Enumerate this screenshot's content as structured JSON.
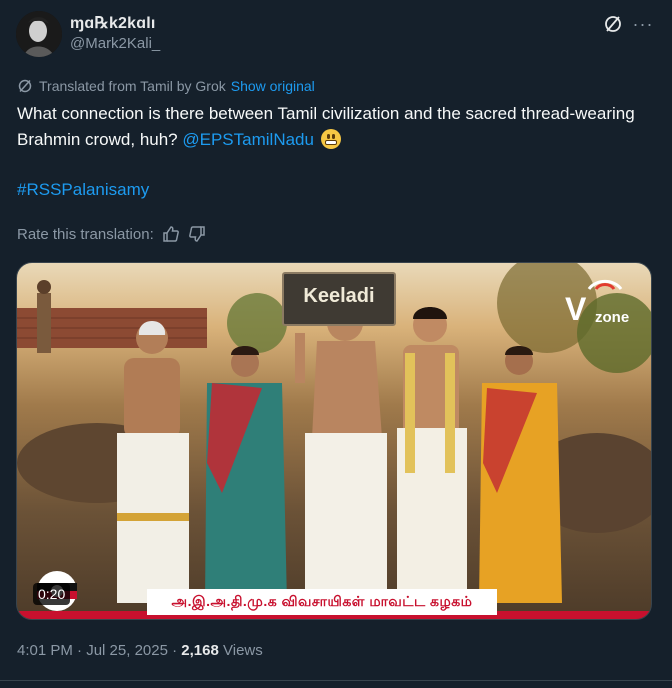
{
  "author": {
    "display_name": "ɱɑ℞k2kɑlı",
    "handle": "@Mark2Kali_",
    "avatar_icon": "avatar-portrait-icon"
  },
  "header_actions": {
    "grok_icon": "grok-icon",
    "more_label": "···"
  },
  "translation": {
    "notice": "Translated from Tamil by Grok",
    "show_original": "Show original"
  },
  "tweet": {
    "text_before_mention": "What connection is there between Tamil civilization and the sacred thread-wearing Brahmin crowd, huh? ",
    "mention": "@EPSTamilNadu",
    "emoji": "grimacing-face",
    "hashtag": "#RSSPalanisamy"
  },
  "rate": {
    "label": "Rate this translation:",
    "up_icon": "thumbs-up-icon",
    "down_icon": "thumbs-down-icon"
  },
  "media": {
    "sign_text": "Keeladi",
    "channel_logo": "Vzone",
    "channel_logo_v": "V",
    "channel_logo_z": "zone",
    "caption": "அ.இ.அ.தி.மு.க விவசாயிகள் மாவட்ட கழகம்",
    "duration": "0:20"
  },
  "meta": {
    "time": "4:01 PM",
    "date": "Jul 25, 2025",
    "separator": " · ",
    "views_count": "2,168",
    "views_label": " Views"
  },
  "colors": {
    "background": "#15202b",
    "link": "#1d9bf0",
    "secondary_text": "#8b98a5",
    "border": "#38444d"
  }
}
